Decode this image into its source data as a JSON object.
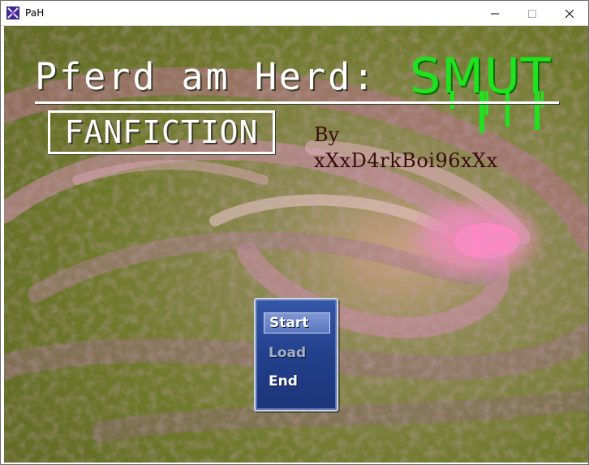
{
  "window": {
    "title": "PaH",
    "icon": "rpg-maker-icon",
    "controls": {
      "minimize": "minimize-icon",
      "maximize": "maximize-icon",
      "close": "close-icon"
    }
  },
  "title_screen": {
    "title_main": "Pferd am Herd:",
    "title_accent": "SMUT",
    "subtitle": "FANFICTION",
    "byline_by": "By",
    "byline_author": "xXxD4rkBoi96xXx",
    "colors": {
      "accent": "#1fe31f",
      "title": "#ffffff",
      "byline": "#3a0b0b"
    }
  },
  "menu": {
    "items": [
      {
        "label": "Start",
        "state": "selected"
      },
      {
        "label": "Load",
        "state": "disabled"
      },
      {
        "label": "End",
        "state": "enabled"
      }
    ],
    "colors": {
      "window": "#23408c",
      "border": "#cfd6e6"
    }
  }
}
